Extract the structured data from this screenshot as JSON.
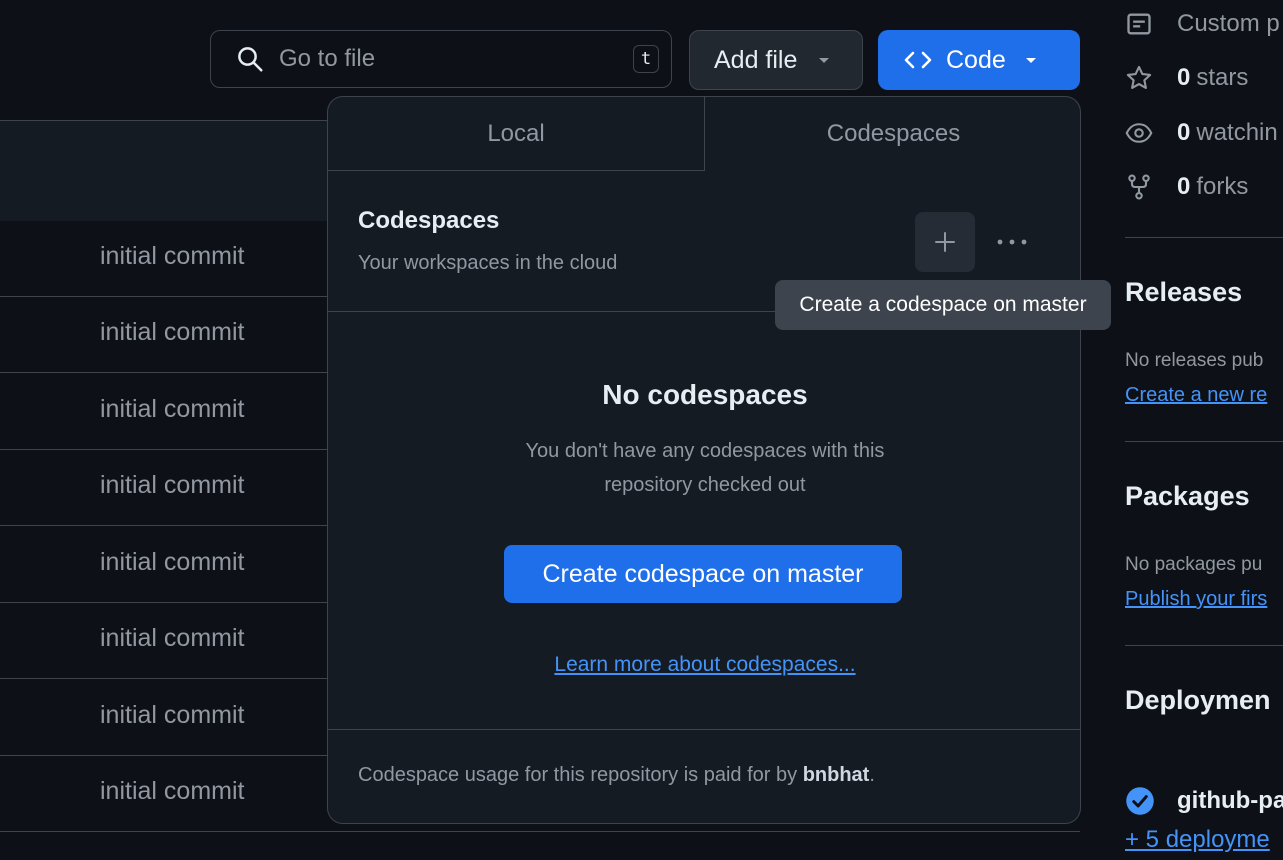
{
  "toolbar": {
    "search_placeholder": "Go to file",
    "search_shortcut": "t",
    "add_file_label": "Add file",
    "code_label": "Code"
  },
  "file_rows": [
    {
      "message": "initial commit"
    },
    {
      "message": "initial commit"
    },
    {
      "message": "initial commit"
    },
    {
      "message": "initial commit"
    },
    {
      "message": "initial commit"
    },
    {
      "message": "initial commit"
    },
    {
      "message": "initial commit"
    },
    {
      "message": "initial commit"
    }
  ],
  "popover": {
    "tabs": [
      {
        "label": "Local",
        "active": false
      },
      {
        "label": "Codespaces",
        "active": true
      }
    ],
    "section_title": "Codespaces",
    "section_subtitle": "Your workspaces in the cloud",
    "empty_title": "No codespaces",
    "empty_text": "You don't have any codespaces with this repository checked out",
    "create_button": "Create codespace on master",
    "learn_more": "Learn more about codespaces...",
    "footer_prefix": "Codespace usage for this repository is paid for by ",
    "footer_user": "bnbhat",
    "footer_suffix": "."
  },
  "tooltip": {
    "text": "Create a codespace on master"
  },
  "sidebar": {
    "custom_properties": "Custom p",
    "stars_count": "0",
    "stars_label": "stars",
    "watching_count": "0",
    "watching_label": "watchin",
    "forks_count": "0",
    "forks_label": "forks",
    "releases_title": "Releases",
    "releases_note": "No releases pub",
    "releases_link": "Create a new re",
    "packages_title": "Packages",
    "packages_note": "No packages pu",
    "packages_link": "Publish your firs",
    "deployments_title": "Deploymen",
    "deployment_name": "github-pa",
    "deployments_more": "+ 5 deployme"
  },
  "colors": {
    "background": "#0d1117",
    "accent": "#1f6feb",
    "link": "#4493f8",
    "border": "#3d444d"
  },
  "icons": [
    "search-icon",
    "caret-down-icon",
    "code-icon",
    "plus-icon",
    "kebab-icon",
    "note-icon",
    "star-icon",
    "eye-icon",
    "fork-icon",
    "check-circle-icon"
  ]
}
